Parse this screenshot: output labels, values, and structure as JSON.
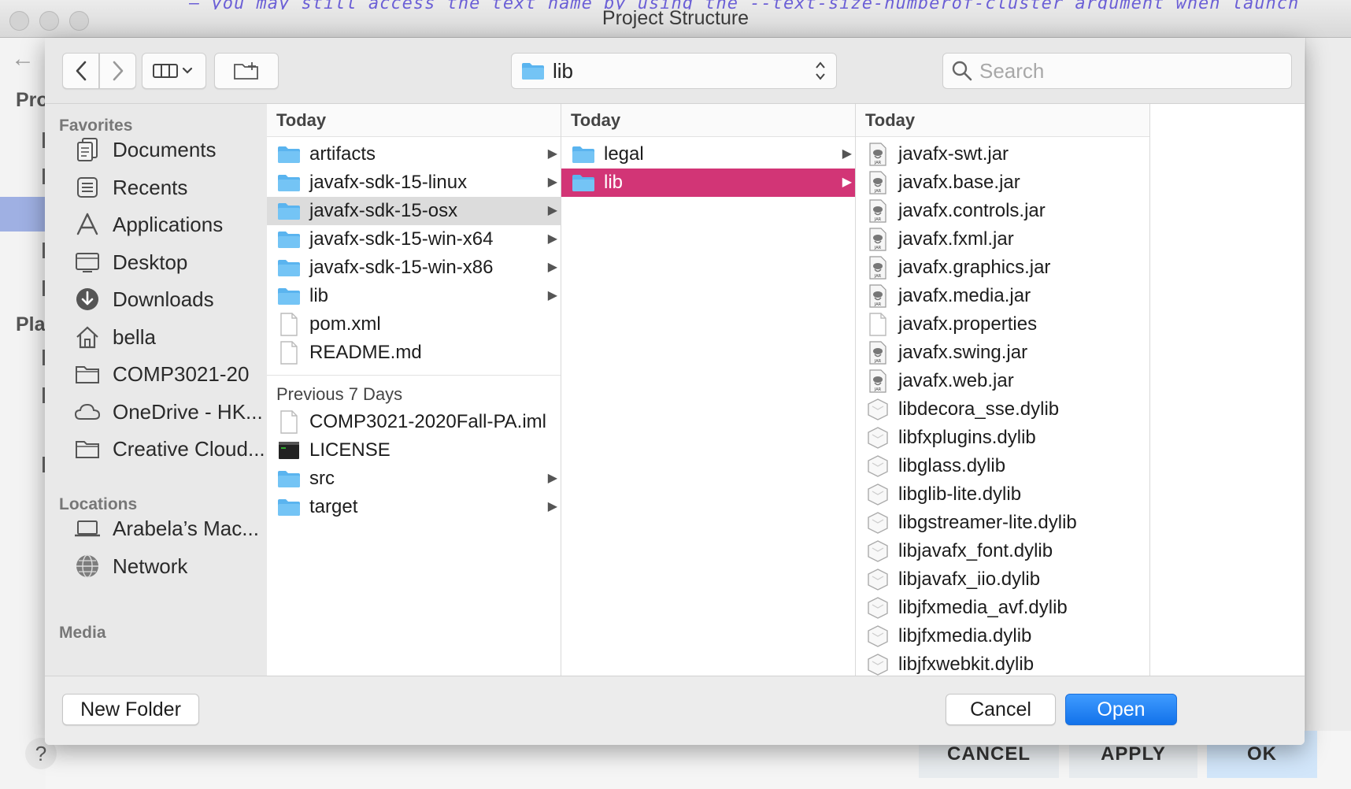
{
  "window": {
    "title": "Project Structure",
    "background_code_fragment": "– you may still access the text name by using the --text-size-numberof-cluster argument when launch"
  },
  "background_ide": {
    "sidebar_fragments": [
      "Pro",
      "Pla"
    ],
    "buttons": {
      "help": "?",
      "cancel": "CANCEL",
      "apply": "APPLY",
      "ok": "OK"
    }
  },
  "toolbar": {
    "back_icon": "chevron-left-icon",
    "forward_icon": "chevron-right-icon",
    "view_icon": "column-view-icon",
    "new_folder_icon": "folder-plus-icon",
    "path_current": "lib",
    "search_placeholder": "Search",
    "search_value": ""
  },
  "sidebar": {
    "favorites_header": "Favorites",
    "favorites": [
      {
        "label": "Documents",
        "icon": "documents-icon"
      },
      {
        "label": "Recents",
        "icon": "recents-icon"
      },
      {
        "label": "Applications",
        "icon": "applications-icon"
      },
      {
        "label": "Desktop",
        "icon": "desktop-icon"
      },
      {
        "label": "Downloads",
        "icon": "downloads-icon"
      },
      {
        "label": "bella",
        "icon": "home-icon"
      },
      {
        "label": "COMP3021-20",
        "icon": "folder-icon"
      },
      {
        "label": "OneDrive - HK...",
        "icon": "cloud-icon"
      },
      {
        "label": "Creative Cloud...",
        "icon": "folder-icon"
      }
    ],
    "locations_header": "Locations",
    "locations": [
      {
        "label": "Arabela’s Mac...",
        "icon": "laptop-icon"
      },
      {
        "label": "Network",
        "icon": "network-icon"
      }
    ],
    "media_header": "Media"
  },
  "columns": [
    {
      "header": "Today",
      "items": [
        {
          "name": "artifacts",
          "kind": "folder",
          "arrow": "▶"
        },
        {
          "name": "javafx-sdk-15-linux",
          "kind": "folder",
          "arrow": "▶"
        },
        {
          "name": "javafx-sdk-15-osx",
          "kind": "folder",
          "arrow": "▶",
          "state": "hover"
        },
        {
          "name": "javafx-sdk-15-win-x64",
          "kind": "folder",
          "arrow": "▶"
        },
        {
          "name": "javafx-sdk-15-win-x86",
          "kind": "folder",
          "arrow": "▶"
        },
        {
          "name": "lib",
          "kind": "folder",
          "arrow": "▶"
        },
        {
          "name": "pom.xml",
          "kind": "file"
        },
        {
          "name": "README.md",
          "kind": "file"
        }
      ],
      "sub_header": "Previous 7 Days",
      "sub_items": [
        {
          "name": "COMP3021-2020Fall-PA.iml",
          "kind": "file"
        },
        {
          "name": "LICENSE",
          "kind": "terminal"
        },
        {
          "name": "src",
          "kind": "folder",
          "arrow": "▶"
        },
        {
          "name": "target",
          "kind": "folder",
          "arrow": "▶"
        }
      ]
    },
    {
      "header": "Today",
      "items": [
        {
          "name": "legal",
          "kind": "folder",
          "arrow": "▶"
        },
        {
          "name": "lib",
          "kind": "folder",
          "arrow": "▶",
          "state": "selected"
        }
      ]
    },
    {
      "header": "Today",
      "items": [
        {
          "name": "javafx-swt.jar",
          "kind": "jar"
        },
        {
          "name": "javafx.base.jar",
          "kind": "jar"
        },
        {
          "name": "javafx.controls.jar",
          "kind": "jar"
        },
        {
          "name": "javafx.fxml.jar",
          "kind": "jar"
        },
        {
          "name": "javafx.graphics.jar",
          "kind": "jar"
        },
        {
          "name": "javafx.media.jar",
          "kind": "jar"
        },
        {
          "name": "javafx.properties",
          "kind": "file"
        },
        {
          "name": "javafx.swing.jar",
          "kind": "jar"
        },
        {
          "name": "javafx.web.jar",
          "kind": "jar"
        },
        {
          "name": "libdecora_sse.dylib",
          "kind": "dylib"
        },
        {
          "name": "libfxplugins.dylib",
          "kind": "dylib"
        },
        {
          "name": "libglass.dylib",
          "kind": "dylib"
        },
        {
          "name": "libglib-lite.dylib",
          "kind": "dylib"
        },
        {
          "name": "libgstreamer-lite.dylib",
          "kind": "dylib"
        },
        {
          "name": "libjavafx_font.dylib",
          "kind": "dylib"
        },
        {
          "name": "libjavafx_iio.dylib",
          "kind": "dylib"
        },
        {
          "name": "libjfxmedia_avf.dylib",
          "kind": "dylib"
        },
        {
          "name": "libjfxmedia.dylib",
          "kind": "dylib"
        },
        {
          "name": "libjfxwebkit.dylib",
          "kind": "dylib"
        }
      ]
    }
  ],
  "footer": {
    "new_folder": "New Folder",
    "cancel": "Cancel",
    "open": "Open"
  },
  "colors": {
    "selection": "#d23576",
    "primary_button": "#1a7cf5",
    "folder": "#5ab4ef"
  }
}
